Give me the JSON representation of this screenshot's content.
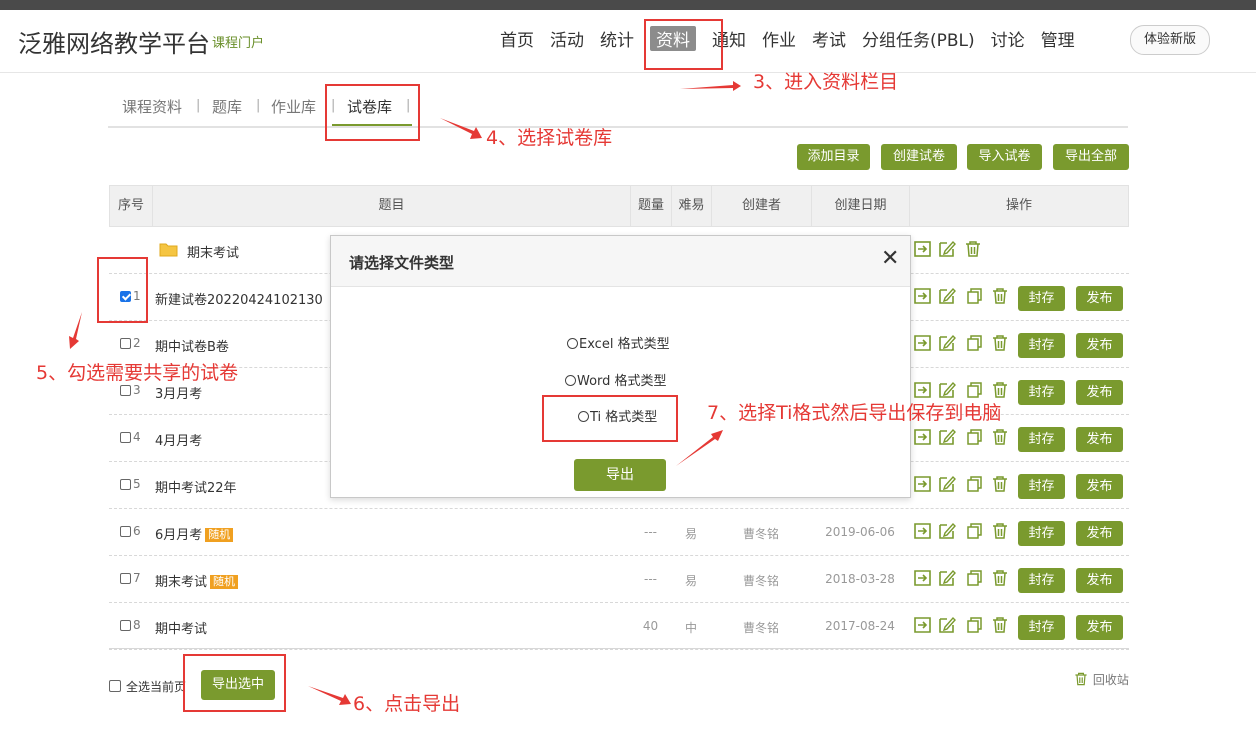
{
  "header": {
    "brand": "泛雅网络教学平台",
    "brand_sub": "课程门户",
    "nav": [
      "首页",
      "活动",
      "统计",
      "资料",
      "通知",
      "作业",
      "考试",
      "分组任务(PBL)",
      "讨论",
      "管理"
    ],
    "active_nav": "资料",
    "new_version": "体验新版"
  },
  "subnav": {
    "tabs": [
      "课程资料",
      "题库",
      "作业库",
      "试卷库"
    ],
    "active": "试卷库"
  },
  "toolbar": [
    "添加目录",
    "创建试卷",
    "导入试卷",
    "导出全部"
  ],
  "table": {
    "headers": [
      "序号",
      "题目",
      "题量",
      "难易",
      "创建者",
      "创建日期",
      "操作"
    ],
    "rows": [
      {
        "type": "folder",
        "title": "期末考试"
      },
      {
        "num": "1",
        "title": "新建试卷20220424102130",
        "checked": true
      },
      {
        "num": "2",
        "title": "期中试卷B卷"
      },
      {
        "num": "3",
        "title": "3月月考"
      },
      {
        "num": "4",
        "title": "4月月考"
      },
      {
        "num": "5",
        "title": "期中考试22年"
      },
      {
        "num": "6",
        "title": "6月月考",
        "tag": "随机",
        "count": "---",
        "difficulty": "易",
        "creator": "曹冬铭",
        "date": "2019-06-06"
      },
      {
        "num": "7",
        "title": "期末考试",
        "tag": "随机",
        "count": "---",
        "difficulty": "易",
        "creator": "曹冬铭",
        "date": "2018-03-28"
      },
      {
        "num": "8",
        "title": "期中考试",
        "count": "40",
        "difficulty": "中",
        "creator": "曹冬铭",
        "date": "2017-08-24"
      }
    ],
    "seal_label": "封存",
    "publish_label": "发布"
  },
  "footer": {
    "select_all": "全选当前页",
    "export_selected": "导出选中",
    "recycle": "回收站"
  },
  "modal": {
    "title": "请选择文件类型",
    "close": "✕",
    "options": [
      "Excel 格式类型",
      "Word 格式类型",
      "Ti 格式类型"
    ],
    "export": "导出"
  },
  "annotations": {
    "a3": "3、进入资料栏目",
    "a4": "4、选择试卷库",
    "a5": "5、勾选需要共享的试卷",
    "a6": "6、点击导出",
    "a7": "7、选择Ti格式然后导出保存到电脑"
  },
  "colors": {
    "brand_green": "#7a9a2e",
    "annotation_red": "#e53935",
    "tag_orange": "#f0a020"
  }
}
